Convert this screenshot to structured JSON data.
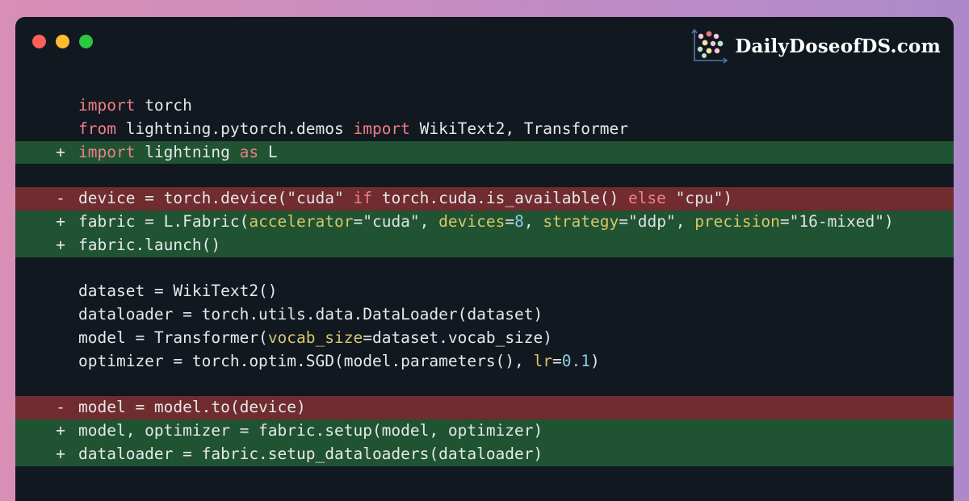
{
  "window": {
    "controls": [
      "close",
      "minimize",
      "maximize"
    ],
    "brand": {
      "text": "DailyDoseofDS.com",
      "icon": "scatter-plot-logo-icon"
    }
  },
  "colors": {
    "added_bg": "#1f5331",
    "removed_bg": "#702c2e",
    "editor_bg": "#111820",
    "keyword": "#f07f86",
    "argument": "#d9c56a",
    "number": "#8fcbe6"
  },
  "diff": [
    {
      "type": "context",
      "marker": "",
      "tokens": [
        [
          "kw",
          "import"
        ],
        [
          "",
          "torch"
        ]
      ]
    },
    {
      "type": "context",
      "marker": "",
      "tokens": [
        [
          "kw",
          "from"
        ],
        [
          "",
          "lightning.pytorch.demos"
        ],
        [
          "kw",
          "import"
        ],
        [
          "",
          "WikiText2, Transformer"
        ]
      ]
    },
    {
      "type": "added",
      "marker": "+",
      "tokens": [
        [
          "kw",
          "import"
        ],
        [
          "",
          "lightning"
        ],
        [
          "kw",
          "as"
        ],
        [
          "",
          "L"
        ]
      ]
    },
    {
      "type": "blank",
      "marker": "",
      "tokens": []
    },
    {
      "type": "removed",
      "marker": "-",
      "tokens": [
        [
          "",
          "device = torch.device("
        ],
        [
          "str",
          "\"cuda\""
        ],
        [
          "kw",
          " if "
        ],
        [
          "",
          "torch.cuda.is_available()"
        ],
        [
          "kw",
          " else "
        ],
        [
          "str",
          "\"cpu\""
        ],
        [
          "",
          ")"
        ]
      ]
    },
    {
      "type": "added",
      "marker": "+",
      "tokens": [
        [
          "",
          "fabric = L.Fabric("
        ],
        [
          "arg",
          "accelerator"
        ],
        [
          "",
          "="
        ],
        [
          "str",
          "\"cuda\""
        ],
        [
          "",
          ", "
        ],
        [
          "arg",
          "devices"
        ],
        [
          "",
          "="
        ],
        [
          "num",
          "8"
        ],
        [
          "",
          ", "
        ],
        [
          "arg",
          "strategy"
        ],
        [
          "",
          "="
        ],
        [
          "str",
          "\"ddp\""
        ],
        [
          "",
          ", "
        ],
        [
          "arg",
          "precision"
        ],
        [
          "",
          "="
        ],
        [
          "str",
          "\"16-mixed\""
        ],
        [
          "",
          ")"
        ]
      ]
    },
    {
      "type": "added",
      "marker": "+",
      "tokens": [
        [
          "",
          "fabric.launch()"
        ]
      ]
    },
    {
      "type": "blank",
      "marker": "",
      "tokens": []
    },
    {
      "type": "context",
      "marker": "",
      "tokens": [
        [
          "",
          "dataset = WikiText2()"
        ]
      ]
    },
    {
      "type": "context",
      "marker": "",
      "tokens": [
        [
          "",
          "dataloader = torch.utils.data.DataLoader(dataset)"
        ]
      ]
    },
    {
      "type": "context",
      "marker": "",
      "tokens": [
        [
          "",
          "model = Transformer("
        ],
        [
          "arg",
          "vocab_size"
        ],
        [
          "",
          "=dataset.vocab_size)"
        ]
      ]
    },
    {
      "type": "context",
      "marker": "",
      "tokens": [
        [
          "",
          "optimizer = torch.optim.SGD(model.parameters(), "
        ],
        [
          "arg",
          "lr"
        ],
        [
          "",
          "="
        ],
        [
          "num",
          "0.1"
        ],
        [
          "",
          ")"
        ]
      ]
    },
    {
      "type": "blank",
      "marker": "",
      "tokens": []
    },
    {
      "type": "removed",
      "marker": "-",
      "tokens": [
        [
          "",
          "model = model.to(device)"
        ]
      ]
    },
    {
      "type": "added",
      "marker": "+",
      "tokens": [
        [
          "",
          "model, optimizer = fabric.setup(model, optimizer)"
        ]
      ]
    },
    {
      "type": "added",
      "marker": "+",
      "tokens": [
        [
          "",
          "dataloader = fabric.setup_dataloaders(dataloader)"
        ]
      ]
    }
  ]
}
